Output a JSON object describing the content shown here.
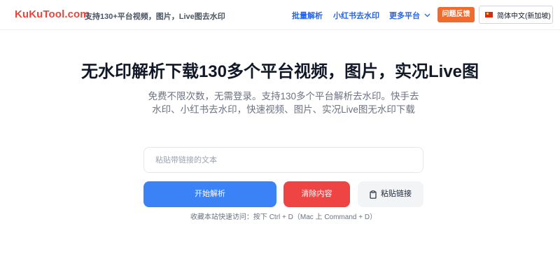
{
  "header": {
    "brand": "KuKuTool.com",
    "tagline": "支持130+平台视频，图片，Live图去水印",
    "nav": {
      "batch": "批量解析",
      "xhs": "小红书去水印",
      "more": "更多平台"
    },
    "feedback": "问题反馈",
    "language": "简体中文(新加坡)",
    "colors": {
      "brand": "#e8453c",
      "nav": "#2563eb",
      "feedback": "#f26b2d"
    }
  },
  "hero": {
    "title": "无水印解析下载130多个平台视频，图片，实况Live图",
    "subtitle": "免费不限次数，无需登录。支持130多个平台解析去水印。快手去水印、小红书去水印，快速视频、图片、实况Live图无水印下载"
  },
  "form": {
    "input_placeholder": "粘贴带链接的文本",
    "input_value": "",
    "parse_label": "开始解析",
    "clear_label": "清除内容",
    "paste_label": "粘贴链接",
    "colors": {
      "parse": "#3b82f6",
      "clear": "#ef4444",
      "paste": "#f3f4f6"
    }
  },
  "hint": "收藏本站快速访问：按下 Ctrl + D（Mac 上 Command + D）"
}
